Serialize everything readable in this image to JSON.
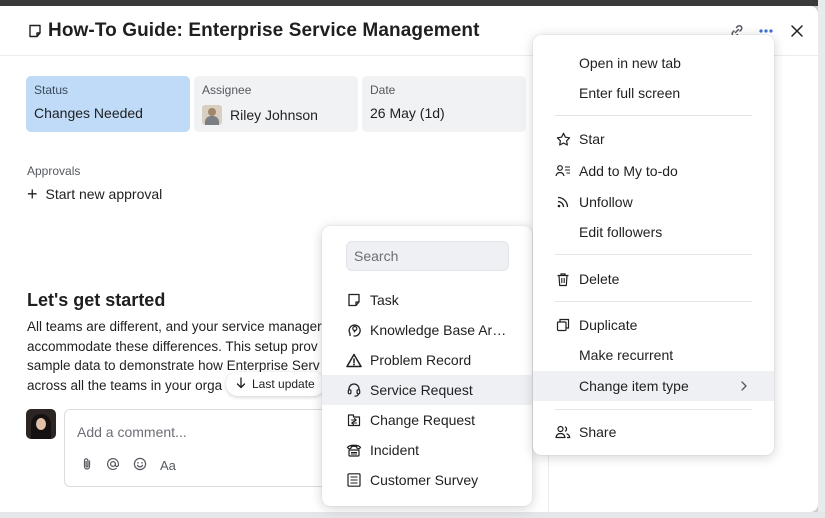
{
  "item": {
    "title": "How-To Guide: Enterprise Service Management"
  },
  "fields": {
    "status": {
      "label": "Status",
      "value": "Changes Needed"
    },
    "assignee": {
      "label": "Assignee",
      "value": "Riley Johnson"
    },
    "date": {
      "label": "Date",
      "value": "26 May (1d)"
    }
  },
  "approvals": {
    "label": "Approvals",
    "start_label": "Start new approval"
  },
  "content": {
    "heading": "Let's get started",
    "lines": [
      "All teams are different, and your service manager",
      "accommodate these differences. This setup prov",
      "sample data to demonstrate how Enterprise Serv",
      "across all the teams in your orga"
    ],
    "last_update_label": "Last update"
  },
  "comment": {
    "placeholder": "Add a comment...",
    "text_format_label": "Aa"
  },
  "type_menu": {
    "search_placeholder": "Search",
    "items": [
      {
        "label": "Task",
        "icon": "task-icon"
      },
      {
        "label": "Knowledge Base Arti...",
        "icon": "lightbulb-head-icon"
      },
      {
        "label": "Problem Record",
        "icon": "warning-triangle-icon"
      },
      {
        "label": "Service Request",
        "icon": "headset-icon",
        "active": true
      },
      {
        "label": "Change Request",
        "icon": "change-request-icon"
      },
      {
        "label": "Incident",
        "icon": "phone-incident-icon"
      },
      {
        "label": "Customer Survey",
        "icon": "survey-icon"
      }
    ]
  },
  "context_menu": {
    "items": [
      {
        "label": "Open in new tab",
        "icon": ""
      },
      {
        "label": "Enter full screen",
        "icon": ""
      },
      {
        "label": "Star",
        "icon": "star-icon"
      },
      {
        "label": "Add to My to-do",
        "icon": "add-todo-icon"
      },
      {
        "label": "Unfollow",
        "icon": "unfollow-icon"
      },
      {
        "label": "Edit followers",
        "icon": ""
      },
      {
        "label": "Delete",
        "icon": "trash-icon"
      },
      {
        "label": "Duplicate",
        "icon": "duplicate-icon"
      },
      {
        "label": "Make recurrent",
        "icon": ""
      },
      {
        "label": "Change item type",
        "icon": "",
        "active": true
      },
      {
        "label": "Share",
        "icon": "share-people-icon"
      }
    ]
  },
  "colors": {
    "status_bg": "#bfdbf7",
    "field_bg": "#f1f2f4",
    "hover_bg": "#eef0f3",
    "text": "#1f1f21"
  }
}
